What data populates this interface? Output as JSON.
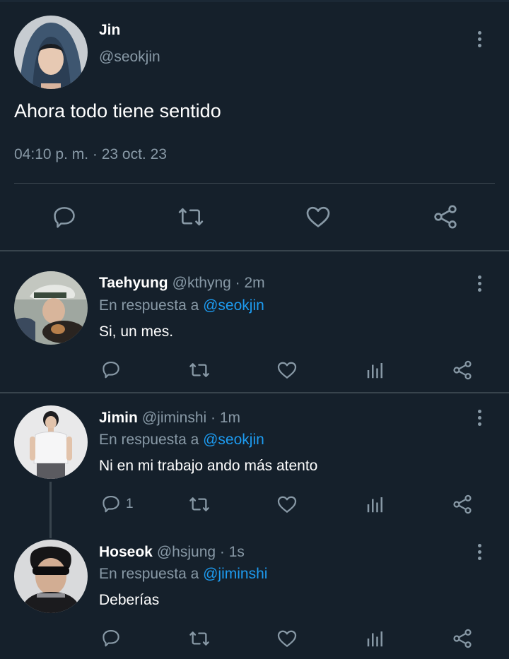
{
  "main_tweet": {
    "name": "Jin",
    "handle": "@seokjin",
    "text": "Ahora todo tiene sentido",
    "timestamp": "04:10 p. m. · 23 oct. 23"
  },
  "replies": [
    {
      "name": "Taehyung",
      "handle_time": "@kthyng · 2m",
      "reply_prefix": "En respuesta a",
      "reply_to": "@seokjin",
      "text": "Si, un mes.",
      "reply_count": ""
    },
    {
      "name": "Jimin",
      "handle_time": "@jiminshi · 1m",
      "reply_prefix": "En respuesta a",
      "reply_to": "@seokjin",
      "text": "Ni en mi trabajo ando más atento",
      "reply_count": "1"
    },
    {
      "name": "Hoseok",
      "handle_time": "@hsjung · 1s",
      "reply_prefix": "En respuesta a",
      "reply_to": "@jiminshi",
      "text": "Deberías",
      "reply_count": ""
    }
  ],
  "colors": {
    "background": "#15202b",
    "icon": "#8899a6",
    "mention": "#1d9bf0",
    "divider": "#38444d"
  }
}
